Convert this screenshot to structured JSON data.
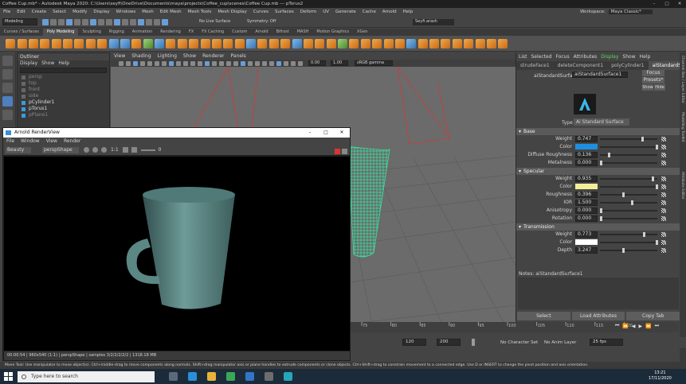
{
  "window": {
    "title": "Coffee Cup.mb* - Autodesk Maya 2020: C:\\Users\\seyfi\\OneDrive\\Documents\\maya\\projects\\Coffee_cup\\scenes\\Coffee Cup.mb --- pTorus2",
    "minimize": "–",
    "maximize": "□",
    "close": "✕"
  },
  "menubar": [
    "File",
    "Edit",
    "Create",
    "Select",
    "Modify",
    "Display",
    "Windows",
    "Mesh",
    "Edit Mesh",
    "Mesh Tools",
    "Mesh Display",
    "Curves",
    "Surfaces",
    "Deform",
    "UV",
    "Generate",
    "Cache",
    "Arnold",
    "Help"
  ],
  "workspace": {
    "label": "Workspace:",
    "value": "Maya Classic*"
  },
  "statusline": {
    "mode": "Modeling",
    "live_surface": "No Live Surface",
    "symmetry": "Symmetry: Off",
    "user": "Seyfi.arash"
  },
  "shelf_tabs": [
    "Curves / Surfaces",
    "Poly Modeling",
    "Sculpting",
    "Rigging",
    "Animation",
    "Rendering",
    "FX",
    "FX Caching",
    "Custom",
    "Arnold",
    "Bifrost",
    "MASH",
    "Motion Graphics",
    "XGen"
  ],
  "shelf_active": "Poly Modeling",
  "outliner": {
    "title": "Outliner",
    "menu": [
      "Display",
      "Show",
      "Help"
    ],
    "items": [
      "persp",
      "top",
      "front",
      "side",
      "pCylinder1",
      "pTorus1",
      "pPlane1"
    ]
  },
  "viewport": {
    "menu": [
      "View",
      "Shading",
      "Lighting",
      "Show",
      "Renderer",
      "Panels"
    ],
    "exposure": "0.00",
    "gamma": "1.00",
    "colorspace": "sRGB gamma"
  },
  "attribute_editor": {
    "tabs": [
      "List",
      "Selected",
      "Focus",
      "Attributes",
      "Display",
      "Show",
      "Help"
    ],
    "active_tab": "Display",
    "node_tabs": [
      "aiStandardSurface1",
      "strudeFace1",
      "deleteComponent1",
      "polyCylinder1"
    ],
    "active_node": "aiStandardSurface1",
    "node_label": "aiStandardSurface:",
    "node_name": "aiStandardSurface1",
    "focus_btn": "Focus",
    "presets_btn": "Presets*",
    "show_btn": "Show",
    "hide_btn": "Hide",
    "type_label": "Type",
    "type_value": "Ai Standard Surface",
    "sections": [
      {
        "title": "Base",
        "rows": [
          {
            "label": "Weight",
            "value": "0.747",
            "slider": 0.747
          },
          {
            "label": "Color",
            "color": "#1e8fe0"
          },
          {
            "label": "Diffuse Roughness",
            "value": "0.136",
            "slider": 0.136
          },
          {
            "label": "Metalness",
            "value": "0.000",
            "slider": 0.0
          }
        ]
      },
      {
        "title": "Specular",
        "rows": [
          {
            "label": "Weight",
            "value": "0.935",
            "slider": 0.935
          },
          {
            "label": "Color",
            "color": "#f3ee9a"
          },
          {
            "label": "Roughness",
            "value": "0.396",
            "slider": 0.396
          },
          {
            "label": "IOR",
            "value": "1.500",
            "slider": 0.55
          },
          {
            "label": "Anisotropy",
            "value": "0.000",
            "slider": 0.0
          },
          {
            "label": "Rotation",
            "value": "0.000",
            "slider": 0.0
          }
        ]
      },
      {
        "title": "Transmission",
        "rows": [
          {
            "label": "Weight",
            "value": "0.773",
            "slider": 0.773
          },
          {
            "label": "Color",
            "color": "#ffffff"
          },
          {
            "label": "Depth",
            "value": "3.247",
            "slider": 0.4
          }
        ]
      }
    ],
    "notes": "Notes: aiStandardSurface1",
    "buttons": [
      "Select",
      "Load Attributes",
      "Copy Tab"
    ]
  },
  "right_strip": [
    "Channel Box / Layer Editor",
    "Modelling Toolkit",
    "Attribute Editor"
  ],
  "arnold": {
    "title": "Arnold RenderView",
    "menu": [
      "File",
      "Window",
      "View",
      "Render"
    ],
    "aov": "Beauty",
    "camera": "perspShape",
    "ratio": "1:1",
    "exposure": "0",
    "status": "00:00:54 | 960x540 (1:1) | perspShape | samples 3/2/2/2/2/2 | 1318.18 MB"
  },
  "timeline": {
    "ticks": [
      "75",
      "80",
      "85",
      "90",
      "95",
      "100",
      "105",
      "110",
      "115",
      "120"
    ],
    "current": "1"
  },
  "range": {
    "start": "120",
    "end": "200",
    "char_set": "No Character Set",
    "anim_layer": "No Anim Layer",
    "fps": "25 fps"
  },
  "helpline": "Move Tool: Use manipulator to move object(s). Ctrl+middle-drag to move components along normals. Shift+drag manipulator axis or plane handles to extrude components or clone objects. Ctrl+Shift+drag to constrain movement to a connected edge. Use D or INSERT to change the pivot position and axis orientation.",
  "taskbar": {
    "search": "Type here to search",
    "time": "13:21",
    "date": "17/11/2020",
    "colors": {
      "bg": "#1c2b3a"
    }
  }
}
